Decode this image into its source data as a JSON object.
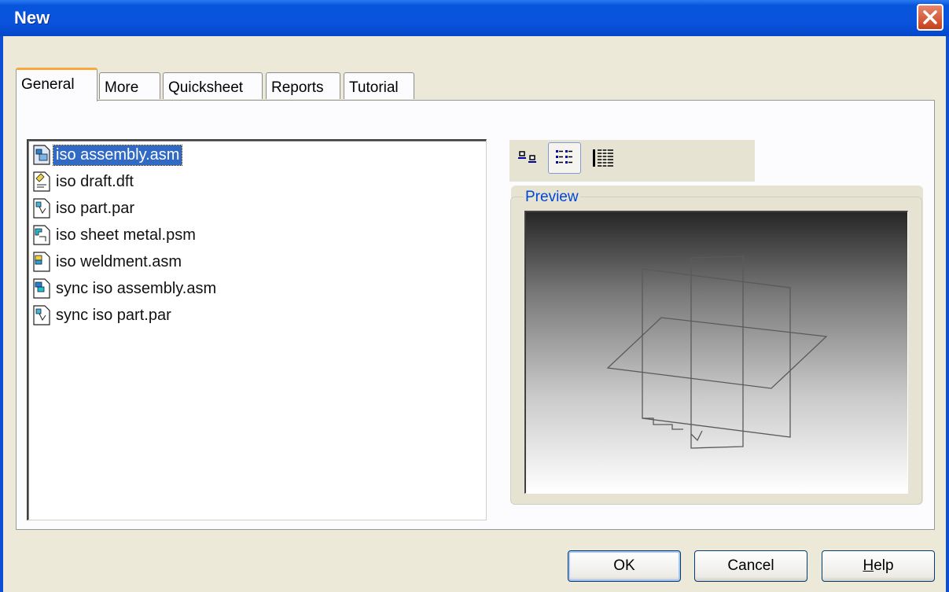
{
  "window": {
    "title": "New"
  },
  "tabs": [
    {
      "label": "General",
      "active": true
    },
    {
      "label": "More",
      "active": false
    },
    {
      "label": "Quicksheet",
      "active": false
    },
    {
      "label": "Reports",
      "active": false
    },
    {
      "label": "Tutorial",
      "active": false
    }
  ],
  "files": [
    {
      "name": "iso assembly.asm",
      "icon": "assembly-file-icon",
      "selected": true
    },
    {
      "name": "iso draft.dft",
      "icon": "draft-file-icon",
      "selected": false
    },
    {
      "name": "iso part.par",
      "icon": "part-file-icon",
      "selected": false
    },
    {
      "name": "iso sheet metal.psm",
      "icon": "sheet-metal-file-icon",
      "selected": false
    },
    {
      "name": "iso weldment.asm",
      "icon": "weldment-file-icon",
      "selected": false
    },
    {
      "name": "sync iso assembly.asm",
      "icon": "assembly-file-icon",
      "selected": false
    },
    {
      "name": "sync iso part.par",
      "icon": "part-file-icon",
      "selected": false
    }
  ],
  "view_modes": [
    {
      "name": "large-icons-view-icon",
      "active": false
    },
    {
      "name": "list-view-icon",
      "active": true
    },
    {
      "name": "details-view-icon",
      "active": false
    }
  ],
  "preview": {
    "label": "Preview"
  },
  "buttons": {
    "ok": "OK",
    "cancel": "Cancel",
    "help_mnemonic": "H",
    "help_rest": "elp"
  },
  "colors": {
    "title_bar": "#0a54dc",
    "selection": "#316ac5",
    "close_button": "#d9512f",
    "tab_highlight": "#f6a83a",
    "preview_label": "#0046d5"
  }
}
